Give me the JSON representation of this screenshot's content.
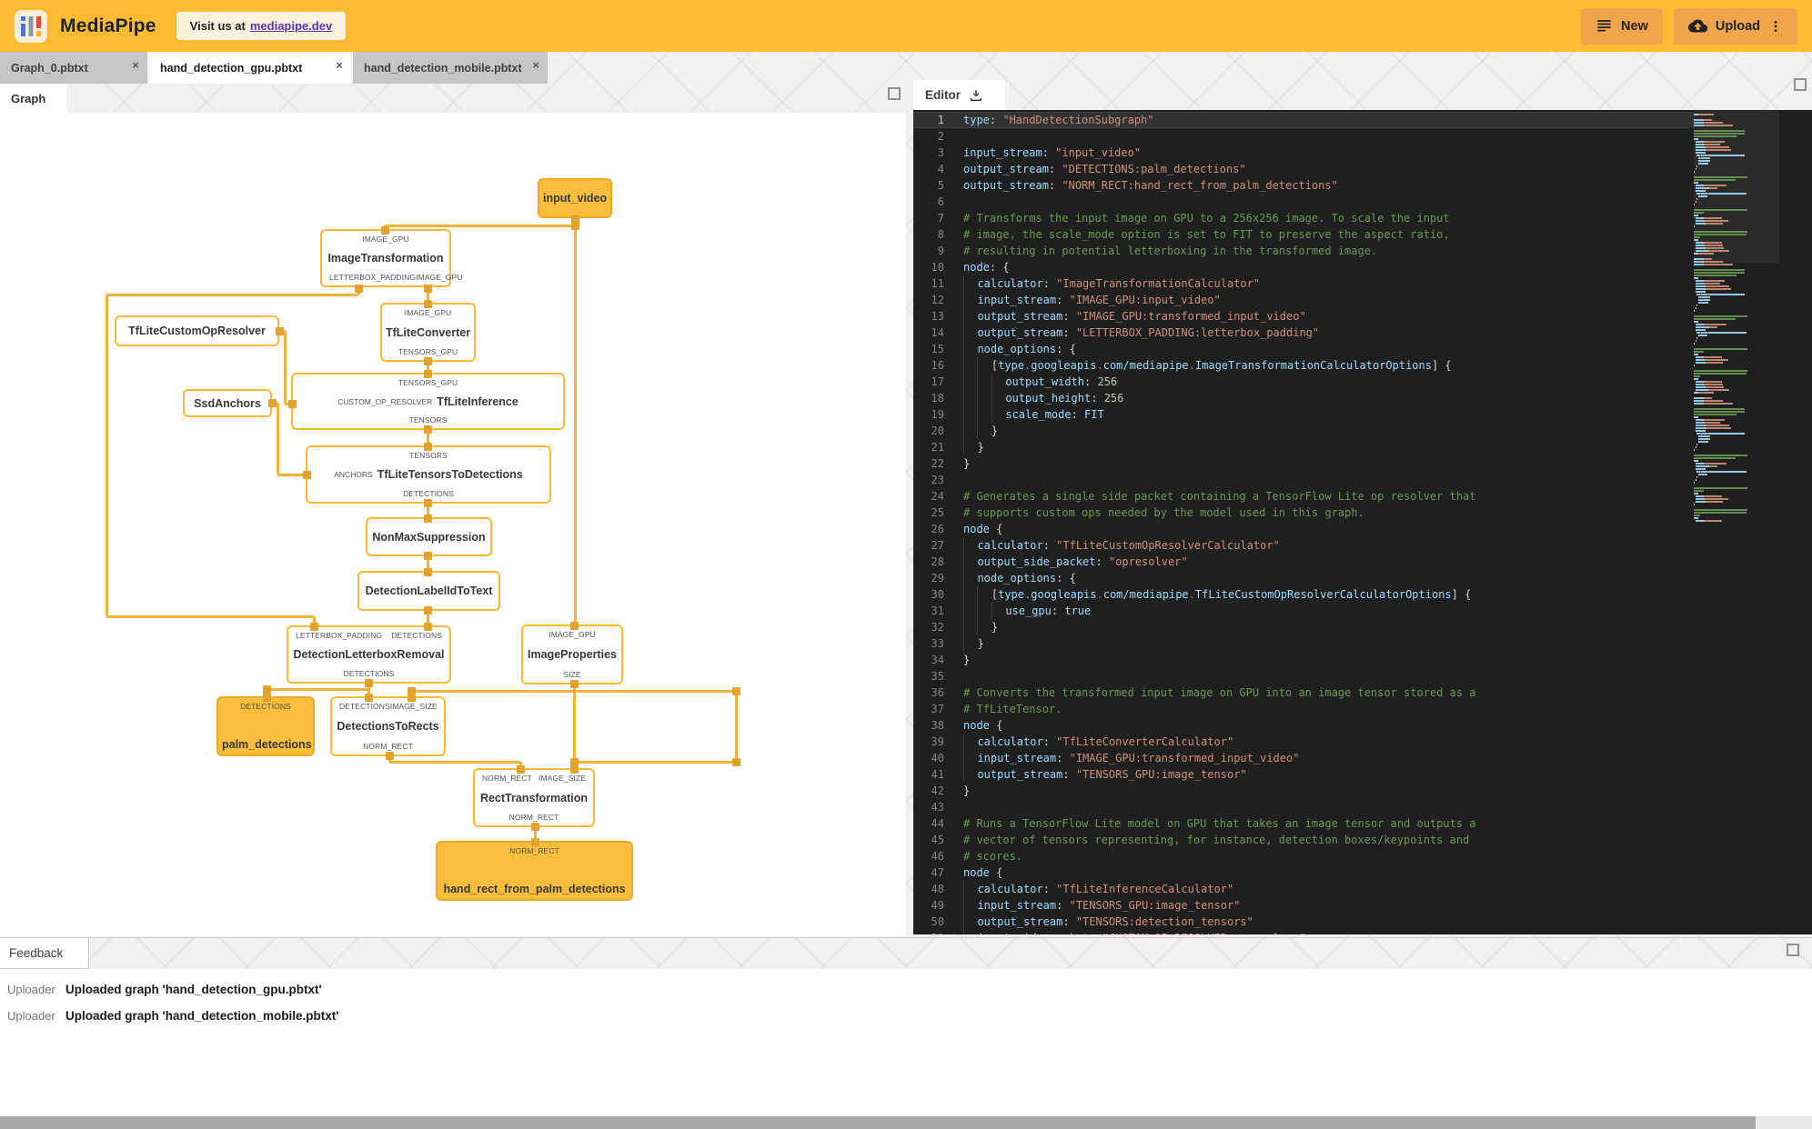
{
  "header": {
    "app_name": "MediaPipe",
    "visit_prefix": "Visit us at",
    "visit_link": "mediapipe.dev",
    "new_label": "New",
    "upload_label": "Upload"
  },
  "tabs": [
    {
      "label": "Graph_0.pbtxt",
      "active": false
    },
    {
      "label": "hand_detection_gpu.pbtxt",
      "active": true
    },
    {
      "label": "hand_detection_mobile.pbtxt",
      "active": false
    }
  ],
  "graph_panel": {
    "tab_label": "Graph",
    "nodes": [
      {
        "title": "input_video",
        "filled": true
      },
      {
        "title": "ImageTransformation",
        "top_ports": [
          "IMAGE_GPU"
        ],
        "bottom_ports": [
          "LETTERBOX_PADDING",
          "IMAGE_GPU"
        ]
      },
      {
        "title": "TfLiteConverter",
        "top_ports": [
          "IMAGE_GPU"
        ],
        "bottom_ports": [
          "TENSORS_GPU"
        ]
      },
      {
        "title": "TfLiteCustomOpResolver"
      },
      {
        "title": "SsdAnchors"
      },
      {
        "title": "TfLiteInference",
        "top_ports": [
          "TENSORS_GPU"
        ],
        "left_port": "CUSTOM_OP_RESOLVER",
        "bottom_ports": [
          "TENSORS"
        ]
      },
      {
        "title": "TfLiteTensorsToDetections",
        "top_ports": [
          "TENSORS"
        ],
        "left_port": "ANCHORS",
        "bottom_ports": [
          "DETECTIONS"
        ]
      },
      {
        "title": "NonMaxSuppression"
      },
      {
        "title": "DetectionLabelIdToText"
      },
      {
        "title": "DetectionLetterboxRemoval",
        "top_ports": [
          "LETTERBOX_PADDING",
          "DETECTIONS"
        ],
        "bottom_ports": [
          "DETECTIONS"
        ]
      },
      {
        "title": "ImageProperties",
        "top_ports": [
          "IMAGE_GPU"
        ],
        "bottom_ports": [
          "SIZE"
        ]
      },
      {
        "title": "palm_detections",
        "filled": true,
        "top_ports": [
          "DETECTIONS"
        ]
      },
      {
        "title": "DetectionsToRects",
        "top_ports": [
          "DETECTIONS",
          "IMAGE_SIZE"
        ],
        "bottom_ports": [
          "NORM_RECT"
        ]
      },
      {
        "title": "RectTransformation",
        "top_ports": [
          "NORM_RECT",
          "IMAGE_SIZE"
        ],
        "bottom_ports": [
          "NORM_RECT"
        ]
      },
      {
        "title": "hand_rect_from_palm_detections",
        "filled": true,
        "top_ports": [
          "NORM_RECT"
        ]
      }
    ]
  },
  "editor_panel": {
    "tab_label": "Editor",
    "code_lines": [
      [
        [
          "k",
          "type"
        ],
        [
          "p",
          ": "
        ],
        [
          "s",
          "\"HandDetectionSubgraph\""
        ]
      ],
      [],
      [
        [
          "k",
          "input_stream"
        ],
        [
          "p",
          ": "
        ],
        [
          "s",
          "\"input_video\""
        ]
      ],
      [
        [
          "k",
          "output_stream"
        ],
        [
          "p",
          ": "
        ],
        [
          "s",
          "\"DETECTIONS:palm_detections\""
        ]
      ],
      [
        [
          "k",
          "output_stream"
        ],
        [
          "p",
          ": "
        ],
        [
          "s",
          "\"NORM_RECT:hand_rect_from_palm_detections\""
        ]
      ],
      [],
      [
        [
          "c",
          "# Transforms the input image on GPU to a 256x256 image. To scale the input"
        ]
      ],
      [
        [
          "c",
          "# image, the scale_mode option is set to FIT to preserve the aspect ratio,"
        ]
      ],
      [
        [
          "c",
          "# resulting in potential letterboxing in the transformed image."
        ]
      ],
      [
        [
          "k",
          "node"
        ],
        [
          "p",
          ": {"
        ]
      ],
      [
        [
          "i",
          "  "
        ],
        [
          "k",
          "calculator"
        ],
        [
          "p",
          ": "
        ],
        [
          "s",
          "\"ImageTransformationCalculator\""
        ]
      ],
      [
        [
          "i",
          "  "
        ],
        [
          "k",
          "input_stream"
        ],
        [
          "p",
          ": "
        ],
        [
          "s",
          "\"IMAGE_GPU:input_video\""
        ]
      ],
      [
        [
          "i",
          "  "
        ],
        [
          "k",
          "output_stream"
        ],
        [
          "p",
          ": "
        ],
        [
          "s",
          "\"IMAGE_GPU:transformed_input_video\""
        ]
      ],
      [
        [
          "i",
          "  "
        ],
        [
          "k",
          "output_stream"
        ],
        [
          "p",
          ": "
        ],
        [
          "s",
          "\"LETTERBOX_PADDING:letterbox_padding\""
        ]
      ],
      [
        [
          "i",
          "  "
        ],
        [
          "k",
          "node_options"
        ],
        [
          "p",
          ": {"
        ]
      ],
      [
        [
          "i",
          "    "
        ],
        [
          "p",
          "["
        ],
        [
          "k",
          "type"
        ],
        [
          "d",
          "."
        ],
        [
          "k",
          "googleapis"
        ],
        [
          "d",
          "."
        ],
        [
          "k",
          "com/mediapipe"
        ],
        [
          "d",
          "."
        ],
        [
          "k",
          "ImageTransformationCalculatorOptions"
        ],
        [
          "p",
          "] {"
        ]
      ],
      [
        [
          "i",
          "      "
        ],
        [
          "k",
          "output_width"
        ],
        [
          "p",
          ": "
        ],
        [
          "n",
          "256"
        ]
      ],
      [
        [
          "i",
          "      "
        ],
        [
          "k",
          "output_height"
        ],
        [
          "p",
          ": "
        ],
        [
          "n",
          "256"
        ]
      ],
      [
        [
          "i",
          "      "
        ],
        [
          "k",
          "scale_mode"
        ],
        [
          "p",
          ": "
        ],
        [
          "k",
          "FIT"
        ]
      ],
      [
        [
          "i",
          "    "
        ],
        [
          "p",
          "}"
        ]
      ],
      [
        [
          "i",
          "  "
        ],
        [
          "p",
          "}"
        ]
      ],
      [
        [
          "p",
          "}"
        ]
      ],
      [],
      [
        [
          "c",
          "# Generates a single side packet containing a TensorFlow Lite op resolver that"
        ]
      ],
      [
        [
          "c",
          "# supports custom ops needed by the model used in this graph."
        ]
      ],
      [
        [
          "k",
          "node"
        ],
        [
          "p",
          " {"
        ]
      ],
      [
        [
          "i",
          "  "
        ],
        [
          "k",
          "calculator"
        ],
        [
          "p",
          ": "
        ],
        [
          "s",
          "\"TfLiteCustomOpResolverCalculator\""
        ]
      ],
      [
        [
          "i",
          "  "
        ],
        [
          "k",
          "output_side_packet"
        ],
        [
          "p",
          ": "
        ],
        [
          "s",
          "\"opresolver\""
        ]
      ],
      [
        [
          "i",
          "  "
        ],
        [
          "k",
          "node_options"
        ],
        [
          "p",
          ": {"
        ]
      ],
      [
        [
          "i",
          "    "
        ],
        [
          "p",
          "["
        ],
        [
          "k",
          "type"
        ],
        [
          "d",
          "."
        ],
        [
          "k",
          "googleapis"
        ],
        [
          "d",
          "."
        ],
        [
          "k",
          "com/mediapipe"
        ],
        [
          "d",
          "."
        ],
        [
          "k",
          "TfLiteCustomOpResolverCalculatorOptions"
        ],
        [
          "p",
          "] {"
        ]
      ],
      [
        [
          "i",
          "      "
        ],
        [
          "k",
          "use_gpu"
        ],
        [
          "p",
          ": "
        ],
        [
          "k",
          "true"
        ]
      ],
      [
        [
          "i",
          "    "
        ],
        [
          "p",
          "}"
        ]
      ],
      [
        [
          "i",
          "  "
        ],
        [
          "p",
          "}"
        ]
      ],
      [
        [
          "p",
          "}"
        ]
      ],
      [],
      [
        [
          "c",
          "# Converts the transformed input image on GPU into an image tensor stored as a"
        ]
      ],
      [
        [
          "c",
          "# TfLiteTensor."
        ]
      ],
      [
        [
          "k",
          "node"
        ],
        [
          "p",
          " {"
        ]
      ],
      [
        [
          "i",
          "  "
        ],
        [
          "k",
          "calculator"
        ],
        [
          "p",
          ": "
        ],
        [
          "s",
          "\"TfLiteConverterCalculator\""
        ]
      ],
      [
        [
          "i",
          "  "
        ],
        [
          "k",
          "input_stream"
        ],
        [
          "p",
          ": "
        ],
        [
          "s",
          "\"IMAGE_GPU:transformed_input_video\""
        ]
      ],
      [
        [
          "i",
          "  "
        ],
        [
          "k",
          "output_stream"
        ],
        [
          "p",
          ": "
        ],
        [
          "s",
          "\"TENSORS_GPU:image_tensor\""
        ]
      ],
      [
        [
          "p",
          "}"
        ]
      ],
      [],
      [
        [
          "c",
          "# Runs a TensorFlow Lite model on GPU that takes an image tensor and outputs a"
        ]
      ],
      [
        [
          "c",
          "# vector of tensors representing, for instance, detection boxes/keypoints and"
        ]
      ],
      [
        [
          "c",
          "# scores."
        ]
      ],
      [
        [
          "k",
          "node"
        ],
        [
          "p",
          " {"
        ]
      ],
      [
        [
          "i",
          "  "
        ],
        [
          "k",
          "calculator"
        ],
        [
          "p",
          ": "
        ],
        [
          "s",
          "\"TfLiteInferenceCalculator\""
        ]
      ],
      [
        [
          "i",
          "  "
        ],
        [
          "k",
          "input_stream"
        ],
        [
          "p",
          ": "
        ],
        [
          "s",
          "\"TENSORS_GPU:image_tensor\""
        ]
      ],
      [
        [
          "i",
          "  "
        ],
        [
          "k",
          "output_stream"
        ],
        [
          "p",
          ": "
        ],
        [
          "s",
          "\"TENSORS:detection_tensors\""
        ]
      ],
      [
        [
          "i",
          "  "
        ],
        [
          "k",
          "input_side_packet"
        ],
        [
          "p",
          ": "
        ],
        [
          "s",
          "\"CUSTOM_OP_RESOLVER:opresolver\""
        ]
      ]
    ]
  },
  "feedback_panel": {
    "tab_label": "Feedback",
    "rows": [
      {
        "source": "Uploader",
        "message": "Uploaded graph 'hand_detection_gpu.pbtxt'"
      },
      {
        "source": "Uploader",
        "message": "Uploaded graph 'hand_detection_mobile.pbtxt'"
      }
    ]
  },
  "colors": {
    "header": "#FBBB33",
    "header_button": "#F1A54A",
    "link_purple": "#5E35B1",
    "node_border": "#F8BA33",
    "node_fill": "#FBBE3C",
    "edge": "#F3B23A",
    "port_square": "#E2A22E",
    "editor_bg": "#1F1F1F",
    "code_key": "#9CDCFE",
    "code_string": "#CE9178",
    "code_comment": "#6A9955",
    "code_number": "#B5CEA8"
  }
}
